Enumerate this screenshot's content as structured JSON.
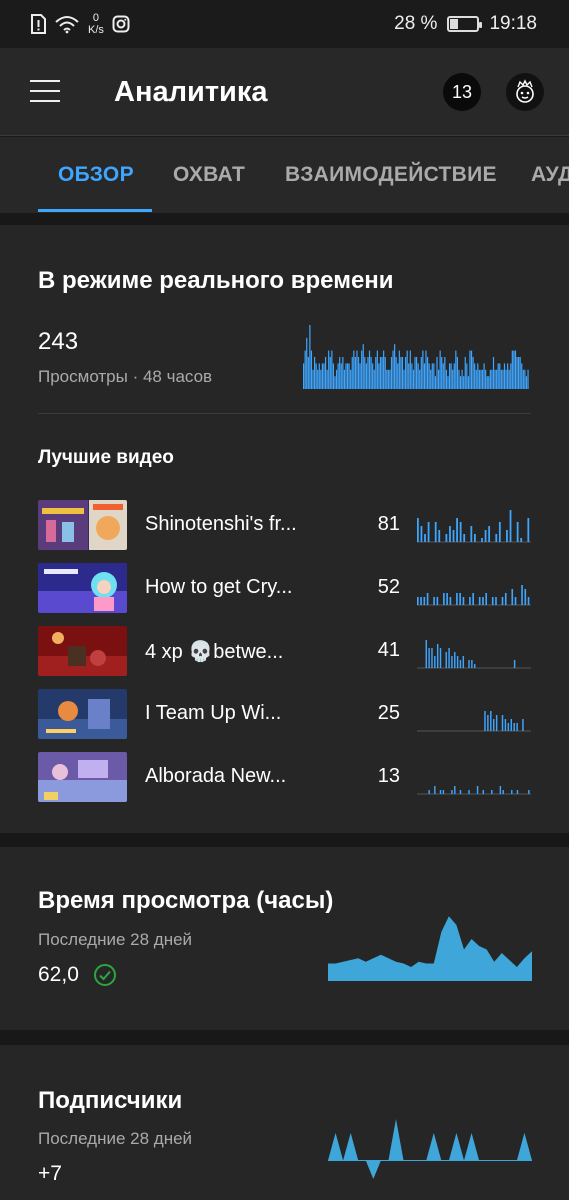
{
  "status_bar": {
    "speed_value": "0",
    "speed_unit": "K/s",
    "battery": "28 %",
    "battery_level": 0.28,
    "time": "19:18"
  },
  "app_bar": {
    "title": "Аналитика",
    "notification_count": "13"
  },
  "tabs": [
    {
      "label": "ОБЗОР",
      "active": true
    },
    {
      "label": "ОХВАТ",
      "active": false
    },
    {
      "label": "ВЗАИМОДЕЙСТВИЕ",
      "active": false
    },
    {
      "label": "АУДИТОРИЯ",
      "active": false
    }
  ],
  "realtime": {
    "title": "В режиме реального времени",
    "value": "243",
    "subtitle": "Просмотры · 48 часов",
    "bars": [
      4,
      6,
      8,
      5,
      10,
      6,
      3,
      5,
      4,
      3,
      4,
      3,
      4,
      4,
      5,
      3,
      6,
      5,
      6,
      4,
      2,
      3,
      4,
      5,
      4,
      5,
      3,
      4,
      4,
      4,
      3,
      5,
      6,
      5,
      6,
      5,
      4,
      6,
      7,
      5,
      4,
      5,
      6,
      5,
      4,
      3,
      5,
      6,
      4,
      5,
      5,
      6,
      5,
      3,
      3,
      3,
      5,
      6,
      7,
      5,
      4,
      6,
      5,
      5,
      3,
      5,
      6,
      4,
      6,
      4,
      3,
      5,
      5,
      4,
      3,
      5,
      6,
      4,
      6,
      5,
      4,
      3,
      4,
      4,
      2,
      5,
      3,
      6,
      5,
      4,
      5,
      3,
      2,
      4,
      4,
      3,
      4,
      6,
      5,
      3,
      2,
      3,
      2,
      5,
      4,
      2,
      6,
      6,
      5,
      4,
      3,
      4,
      3,
      3,
      3,
      4,
      3,
      2,
      2,
      3,
      3,
      5,
      3,
      3,
      4,
      4,
      3,
      3,
      4,
      3,
      4,
      3,
      4,
      6,
      6,
      6,
      5,
      5,
      5,
      4,
      3,
      3,
      2,
      3
    ],
    "top_videos_title": "Лучшие видео",
    "top_videos": [
      {
        "title": "Shinotenshi's fr...",
        "count": "81",
        "spark": [
          6,
          4,
          2,
          5,
          0,
          5,
          3,
          0,
          2,
          4,
          3,
          6,
          5,
          2,
          0,
          4,
          2,
          0,
          1,
          3,
          4,
          0,
          2,
          5,
          0,
          3,
          8,
          0,
          5,
          1,
          0,
          6
        ]
      },
      {
        "title": "How to get Cry...",
        "count": "52",
        "spark": [
          2,
          2,
          2,
          3,
          0,
          2,
          2,
          0,
          3,
          3,
          2,
          0,
          3,
          3,
          2,
          0,
          2,
          3,
          0,
          2,
          2,
          3,
          0,
          2,
          2,
          0,
          2,
          3,
          0,
          4,
          2,
          0,
          5,
          4,
          2
        ]
      },
      {
        "title": "4 xp 💀betwe...",
        "count": "41",
        "spark": [
          0,
          0,
          0,
          7,
          5,
          5,
          3,
          6,
          5,
          0,
          4,
          5,
          3,
          4,
          3,
          2,
          3,
          0,
          2,
          2,
          1,
          0,
          0,
          0,
          0,
          0,
          0,
          0,
          0,
          0,
          0,
          0,
          0,
          0,
          2,
          0,
          0,
          0,
          0,
          0
        ]
      },
      {
        "title": "I Team Up Wi...",
        "count": "25",
        "spark": [
          0,
          0,
          0,
          0,
          0,
          0,
          0,
          0,
          0,
          0,
          0,
          0,
          0,
          0,
          0,
          0,
          0,
          0,
          0,
          0,
          0,
          0,
          0,
          5,
          4,
          5,
          3,
          4,
          0,
          4,
          3,
          2,
          3,
          2,
          2,
          0,
          3,
          0,
          0
        ]
      },
      {
        "title": "Alborada New...",
        "count": "13",
        "spark": [
          0,
          0,
          0,
          0,
          1,
          0,
          2,
          0,
          1,
          1,
          0,
          0,
          1,
          2,
          0,
          1,
          0,
          0,
          1,
          0,
          0,
          2,
          0,
          1,
          0,
          0,
          1,
          0,
          0,
          2,
          1,
          0,
          0,
          1,
          0,
          1,
          0,
          0,
          0,
          1
        ]
      }
    ]
  },
  "watch_time": {
    "title": "Время просмотра (часы)",
    "subtitle": "Последние 28 дней",
    "value": "62,0",
    "series": [
      2,
      2,
      2.2,
      2.4,
      2.6,
      2.2,
      2.6,
      3,
      2.6,
      2.2,
      2,
      1.6,
      2.2,
      2,
      2,
      5.6,
      7.4,
      6.4,
      3.6,
      4.8,
      4,
      3.6,
      2.2,
      3.2,
      2.4,
      1.6,
      2.6,
      3.4
    ]
  },
  "subscribers": {
    "title": "Подписчики",
    "subtitle": "Последние 28 дней",
    "value": "+7",
    "series": [
      0,
      2,
      0,
      2,
      0,
      0,
      -1,
      0,
      0,
      3,
      0,
      0,
      0,
      0,
      2,
      0,
      0,
      2,
      0,
      2,
      0,
      0,
      0,
      0,
      0,
      0,
      2,
      0
    ]
  }
}
